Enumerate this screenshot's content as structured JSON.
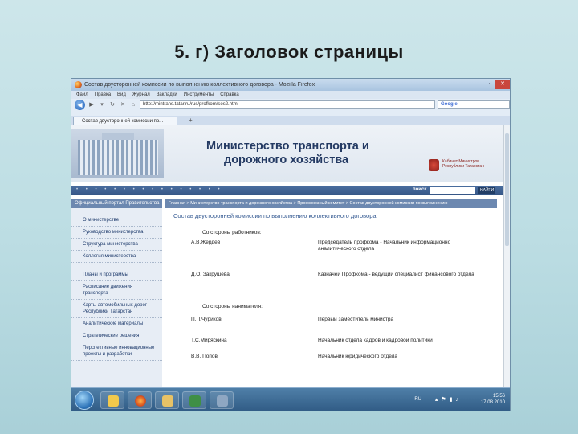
{
  "slide": {
    "title": "5. г) Заголовок страницы"
  },
  "browser": {
    "window_title": "Состав двусторонней комиссии по выполнению коллективного договора - Mozilla Firefox",
    "menu": [
      "Файл",
      "Правка",
      "Вид",
      "Журнал",
      "Закладки",
      "Инструменты",
      "Справка"
    ],
    "url": "http://mintrans.tatar.ru/rus/profkom/sos2.htm",
    "search_placeholder": "Google",
    "tab_label": "Состав двусторонней комиссии по..."
  },
  "site": {
    "ministry_line1": "Министерство транспорта и",
    "ministry_line2": "дорожного хозяйства",
    "gov_line1": "Кабинет Министров",
    "gov_line2": "Республики Татарстан",
    "search_label": "поиск",
    "search_go": "НАЙТИ",
    "nav_dots": "• • • • • • • • • • • • • • • •"
  },
  "leftnav": {
    "head": "Официальный портал Правительства",
    "items": [
      "О министерстве",
      "Руководство министерства",
      "Структура министерства",
      "Коллегия министерства",
      "Планы и программы",
      "Расписание движения транспорта",
      "Карты автомобильных дорог Республики Татарстан",
      "Аналитические материалы",
      "Стратегические решения",
      "Перспективные инновационные проекты и разработки"
    ]
  },
  "content": {
    "breadcrumb": "Главная > Министерство транспорта и дорожного хозяйства > Профсоюзный комитет > Состав двусторонней комиссии по выполнению",
    "page_heading": "Состав двусторонней комиссии по выполнению коллективного договора",
    "section_workers": "Со стороны работников:",
    "section_employer": "Со стороны нанимателя:",
    "rows": [
      {
        "name": "А.В.Жердев",
        "position": "Председатель профкома - Начальник информационно аналитического отдела"
      },
      {
        "name": "Д.О. Закрушева",
        "position": "Казначей Профкома - ведущий специалист финансового отдела"
      },
      {
        "name": "П.П.Чуриков",
        "position": "Первый заместитель министра"
      },
      {
        "name": "Т.С.Миряскина",
        "position": "Начальник отдела кадров и кадровой политики"
      },
      {
        "name": "В.В. Попов",
        "position": "Начальник юридического отдела"
      }
    ]
  },
  "taskbar": {
    "lang": "RU",
    "time": "15:56",
    "date": "17.08.2010"
  }
}
